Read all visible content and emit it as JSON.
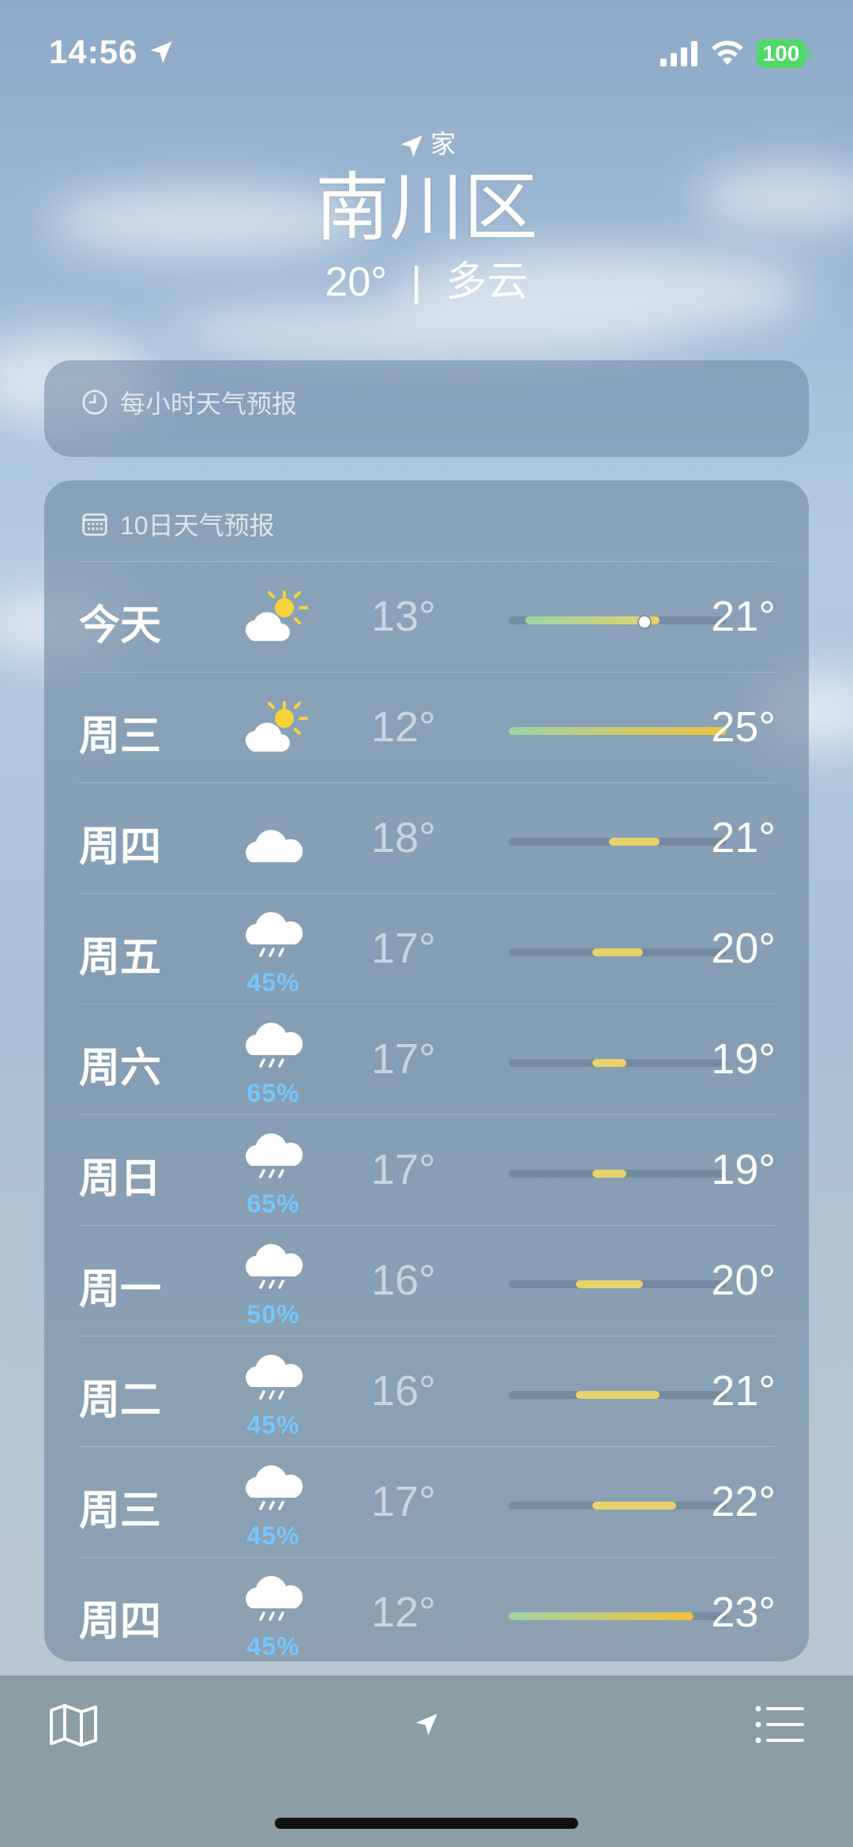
{
  "status_bar": {
    "time": "14:56",
    "battery": "100"
  },
  "location": {
    "label": "家",
    "city": "南川区",
    "current_temp": "20°",
    "separator": "|",
    "condition": "多云"
  },
  "hourly_card": {
    "title": "每小时天气预报"
  },
  "ten_day": {
    "title": "10日天气预报",
    "range": {
      "min": 12,
      "max": 25
    },
    "current_temp_value": 20,
    "days": [
      {
        "day": "今天",
        "icon": "partly-sunny-icon",
        "precip": "",
        "low": "13°",
        "high": "21°",
        "low_val": 13,
        "high_val": 21,
        "current": true
      },
      {
        "day": "周三",
        "icon": "partly-sunny-icon",
        "precip": "",
        "low": "12°",
        "high": "25°",
        "low_val": 12,
        "high_val": 25
      },
      {
        "day": "周四",
        "icon": "cloud-icon",
        "precip": "",
        "low": "18°",
        "high": "21°",
        "low_val": 18,
        "high_val": 21
      },
      {
        "day": "周五",
        "icon": "rain-icon",
        "precip": "45%",
        "low": "17°",
        "high": "20°",
        "low_val": 17,
        "high_val": 20
      },
      {
        "day": "周六",
        "icon": "rain-icon",
        "precip": "65%",
        "low": "17°",
        "high": "19°",
        "low_val": 17,
        "high_val": 19
      },
      {
        "day": "周日",
        "icon": "rain-icon",
        "precip": "65%",
        "low": "17°",
        "high": "19°",
        "low_val": 17,
        "high_val": 19
      },
      {
        "day": "周一",
        "icon": "rain-icon",
        "precip": "50%",
        "low": "16°",
        "high": "20°",
        "low_val": 16,
        "high_val": 20
      },
      {
        "day": "周二",
        "icon": "rain-icon",
        "precip": "45%",
        "low": "16°",
        "high": "21°",
        "low_val": 16,
        "high_val": 21
      },
      {
        "day": "周三",
        "icon": "rain-icon",
        "precip": "45%",
        "low": "17°",
        "high": "22°",
        "low_val": 17,
        "high_val": 22
      },
      {
        "day": "周四",
        "icon": "rain-icon",
        "precip": "45%",
        "low": "12°",
        "high": "23°",
        "low_val": 12,
        "high_val": 23
      }
    ]
  },
  "tab_bar": {
    "left_icon": "map-icon",
    "center_icon": "location-arrow-icon",
    "right_icon": "list-icon"
  },
  "colors": {
    "cool": "#9ed3a6",
    "warm": "#f0c23a",
    "mild": "#e7d36a",
    "precip": "#74c6ff"
  }
}
